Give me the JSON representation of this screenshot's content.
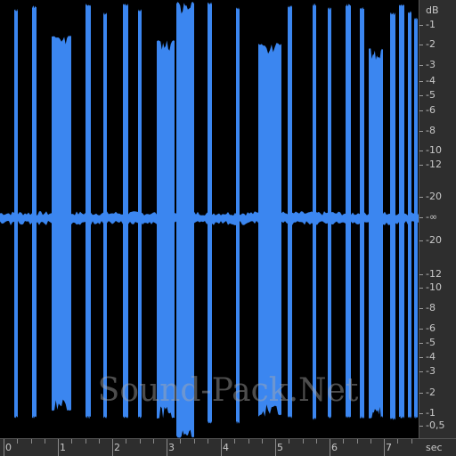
{
  "colors": {
    "waveform": "#3b86f0",
    "background": "#000000",
    "ruler_background": "#2e2e2e",
    "ruler_text": "#c8c8c8"
  },
  "db_scale": {
    "unit": "dB",
    "labels": [
      "-1",
      "-2",
      "-3",
      "-4",
      "-5",
      "-6",
      "-8",
      "-10",
      "-12",
      "-20",
      "-∞",
      "-20",
      "-12",
      "-10",
      "-8",
      "-6",
      "-5",
      "-4",
      "-3",
      "-2",
      "-1",
      "-0,5"
    ]
  },
  "time_ruler": {
    "unit": "sec",
    "labels": [
      "0",
      "1",
      "2",
      "3",
      "4",
      "5",
      "6",
      "7"
    ]
  },
  "watermark": "Sound-Pack.Net"
}
